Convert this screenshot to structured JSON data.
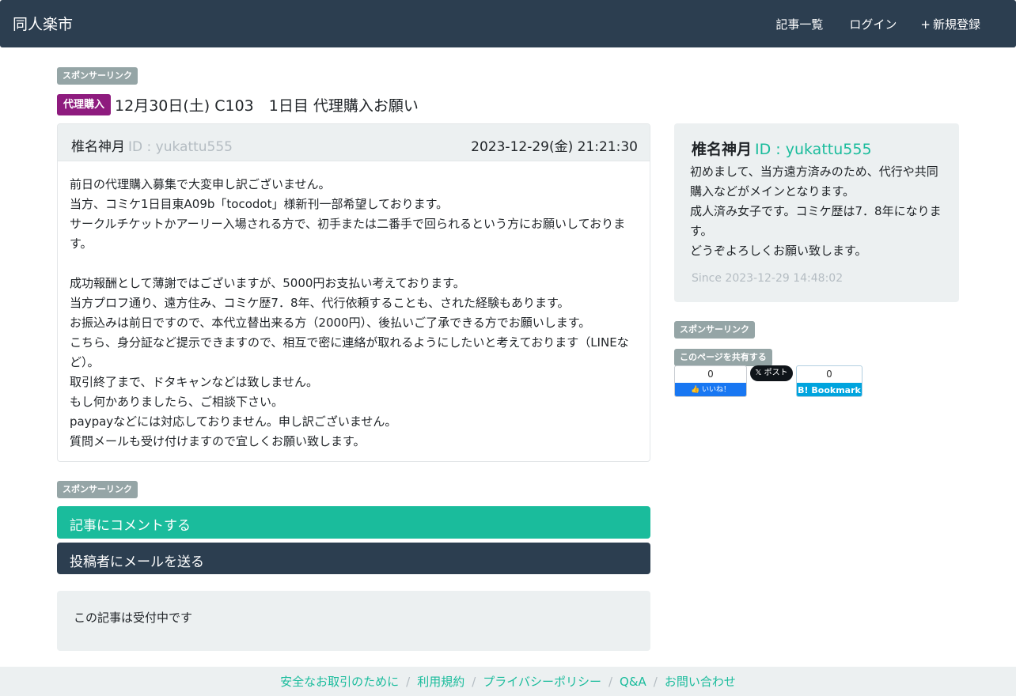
{
  "navbar": {
    "brand": "同人楽市",
    "links": [
      {
        "icon": "list-icon",
        "glyph": "",
        "label": "記事一覧"
      },
      {
        "icon": "login-icon",
        "glyph": "",
        "label": "ログイン"
      },
      {
        "icon": "plus-icon",
        "glyph": "+",
        "label": "新規登録"
      }
    ]
  },
  "sponsor_label": "スポンサーリンク",
  "post": {
    "category": "代理購入",
    "title": "12月30日(土) C103　1日目 代理購入お願い",
    "author_name": "椎名神月",
    "author_id": "ID : yukattu555",
    "date": "2023-12-29(金) 21:21:30",
    "body": [
      "前日の代理購入募集で大変申し訳ございません。",
      "当方、コミケ1日目東A09b「tocodot」様新刊一部希望しております。",
      "サークルチケットかアーリー入場される方で、初手または二番手で回られるという方にお願いしております。",
      "",
      "成功報酬として薄謝ではございますが、5000円お支払い考えております。",
      "当方プロフ通り、遠方住み、コミケ歴7．8年、代行依頼することも、された経験もあります。",
      "お振込みは前日ですので、本代立替出来る方（2000円）、後払いご了承できる方でお願いします。",
      "こちら、身分証など提示できますので、相互で密に連絡が取れるようにしたいと考えております（LINEなど）。",
      "取引終了まで、ドタキャンなどは致しません。",
      "もし何かありましたら、ご相談下さい。",
      "paypayなどには対応しておりません。申し訳ございません。",
      "質問メールも受け付けますので宜しくお願い致します。"
    ]
  },
  "actions": {
    "comment": "記事にコメントする",
    "mail": "投稿者にメールを送る"
  },
  "status": "この記事は受付中です",
  "profile": {
    "name": "椎名神月",
    "id": "ID : yukattu555",
    "intro": [
      "初めまして、当方遠方済みのため、代行や共同購入などがメインとなります。",
      "成人済み女子です。コミケ歴は7．8年になります。",
      "どうぞよろしくお願い致します。"
    ],
    "since": "Since 2023-12-29 14:48:02"
  },
  "share": {
    "label": "このページを共有する",
    "facebook_count": "0",
    "facebook_label": "いいね！",
    "x_label": "ポスト",
    "hatena_count": "0",
    "hatena_label": "B! Bookmark"
  },
  "footer": {
    "links": [
      "安全なお取引のために",
      "利用規約",
      "プライバシーポリシー",
      "Q&A",
      "お問い合わせ"
    ]
  },
  "colors": {
    "navbar": "#2c3e50",
    "accent": "#1abc9c",
    "category": "#8e1b7e",
    "panel": "#ecf0f1"
  }
}
